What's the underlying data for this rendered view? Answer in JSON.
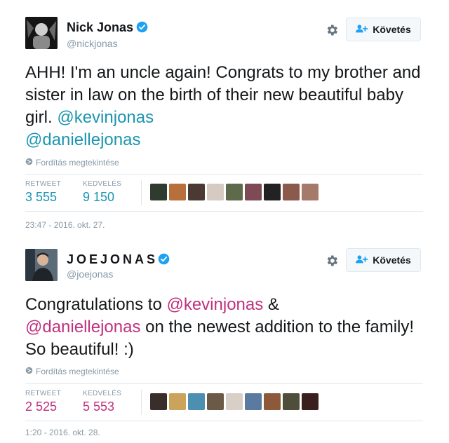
{
  "tweets": [
    {
      "author_name": "Nick Jonas",
      "handle": "@nickjonas",
      "follow_label": "Követés",
      "text_plain": "AHH! I'm an uncle again! Congrats to my brother and sister in law on the birth of their new beautiful baby girl. ",
      "mention_1": "@kevinjonas",
      "mention_2": "@daniellejonas",
      "translate_label": "Fordítás megtekintése",
      "retweet_label": "RETWEET",
      "retweet_count": "3 555",
      "like_label": "KEDVELÉS",
      "like_count": "9 150",
      "timestamp": "23:47 - 2016. okt. 27.",
      "liker_avatar_colors": [
        "#2f3b2e",
        "#b7703c",
        "#4b3a33",
        "#d5cbc3",
        "#5d6b4a",
        "#7d4a55",
        "#222222",
        "#8a5b4c",
        "#a67a6a"
      ]
    },
    {
      "author_name": "JOEJONAS",
      "handle": "@joejonas",
      "follow_label": "Követés",
      "text_pre": "Congratulations to ",
      "mention_1": "@kevinjonas",
      "text_mid": " & ",
      "mention_2": "@daniellejonas",
      "text_post": " on the newest addition to the family! So beautiful! :)",
      "translate_label": "Fordítás megtekintése",
      "retweet_label": "RETWEET",
      "retweet_count": "2 525",
      "like_label": "KEDVELÉS",
      "like_count": "5 553",
      "timestamp": "1:20 - 2016. okt. 28.",
      "liker_avatar_colors": [
        "#3a2e2a",
        "#c9a45a",
        "#4c8fb0",
        "#6b5a48",
        "#d8cfc6",
        "#5b7aa0",
        "#8c5a3a",
        "#4e4e3a",
        "#3b1f1f"
      ]
    }
  ],
  "colors": {
    "link_tweet_1": "#1b95b0",
    "link_tweet_2": "#c0317d",
    "verified": "#1da1f2"
  },
  "icons": [
    "verified-badge-icon",
    "gear-icon",
    "follow-person-plus-icon",
    "globe-icon"
  ]
}
